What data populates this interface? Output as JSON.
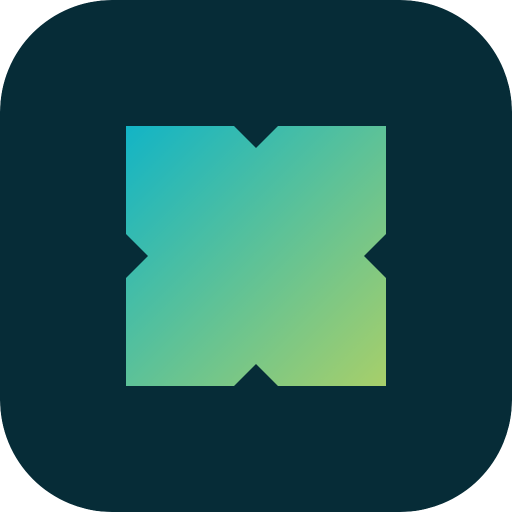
{
  "app_icon": {
    "icon_name": "notched-square-logo-icon",
    "background_color": "#062c37",
    "gradient_start_color": "#12b4c6",
    "gradient_end_color": "#a7cf6a"
  }
}
